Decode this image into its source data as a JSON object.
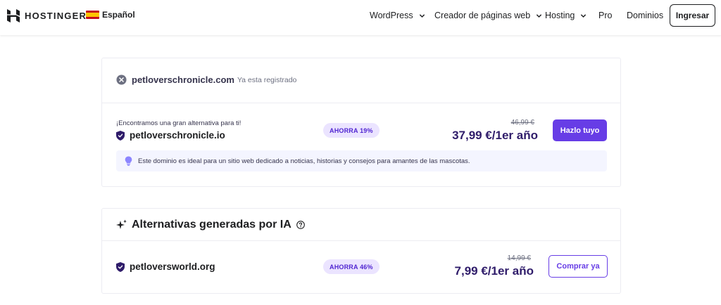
{
  "header": {
    "brand": "HOSTINGER",
    "language": "Español",
    "nav": {
      "wordpress": "WordPress",
      "creador": "Creador de páginas web",
      "hosting": "Hosting",
      "pro": "Pro",
      "dominios": "Dominios"
    },
    "login": "Ingresar"
  },
  "search_result": {
    "domain": "petloverschronicle.com",
    "status": "Ya esta registrado"
  },
  "alternative": {
    "label": "¡Encontramos una gran alternativa para ti!",
    "domain": "petloverschronicle.io",
    "badge": "AHORRA 19%",
    "old_price": "46,99 €",
    "price": "37,99 €/1er año",
    "button": "Hazlo tuyo",
    "tip": "Este dominio es ideal para un sitio web dedicado a noticias, historias y consejos para amantes de las mascotas."
  },
  "ai_alternatives": {
    "title": "Alternativas generadas por IA",
    "items": [
      {
        "domain": "petloversworld.org",
        "badge": "AHORRA 46%",
        "old_price": "14,99 €",
        "price": "7,99 €/1er año",
        "button": "Comprar ya"
      }
    ]
  },
  "colors": {
    "accent": "#673de6",
    "badge_bg": "#ebe4ff",
    "price": "#2f1c6a"
  }
}
